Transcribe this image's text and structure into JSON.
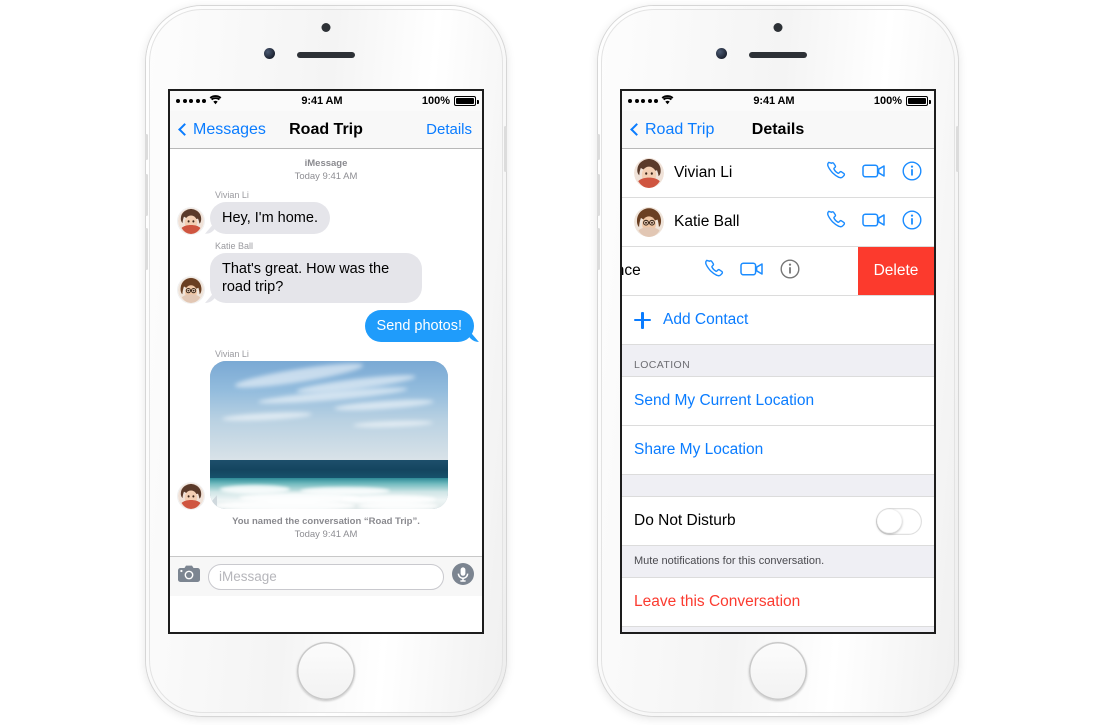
{
  "phones": {
    "left": {
      "status_bar": {
        "signal_dots": 5,
        "wifi_icon": "wifi-icon",
        "time": "9:41 AM",
        "battery_percent": "100%",
        "battery_icon": "battery-full-icon"
      },
      "nav": {
        "back_label": "Messages",
        "back_icon": "chevron-left-icon",
        "title": "Road Trip",
        "right_label": "Details"
      },
      "conversation": {
        "service_stamp": "iMessage",
        "time_stamp": "Today 9:41 AM",
        "messages": [
          {
            "sender": "Vivian Li",
            "text": "Hey, I'm home.",
            "direction": "in",
            "type": "text",
            "avatar": "vivian-avatar"
          },
          {
            "sender": "Katie Ball",
            "text": "That's great. How was the road trip?",
            "direction": "in",
            "type": "text",
            "avatar": "katie-avatar"
          },
          {
            "sender": "",
            "text": "Send photos!",
            "direction": "out",
            "type": "text",
            "avatar": ""
          },
          {
            "sender": "Vivian Li",
            "text": "",
            "direction": "in",
            "type": "photo",
            "avatar": "vivian-avatar",
            "photo_alt": "ocean-beach-photo"
          }
        ],
        "system_note_line1": "You named the conversation “Road Trip”.",
        "system_note_line2": "Today 9:41 AM"
      },
      "input_bar": {
        "camera_icon": "camera-icon",
        "placeholder": "iMessage",
        "value": "",
        "mic_icon": "microphone-icon"
      }
    },
    "right": {
      "status_bar": {
        "signal_dots": 5,
        "wifi_icon": "wifi-icon",
        "time": "9:41 AM",
        "battery_percent": "100%",
        "battery_icon": "battery-full-icon"
      },
      "nav": {
        "back_label": "Road Trip",
        "back_icon": "chevron-left-icon",
        "title": "Details",
        "right_label": ""
      },
      "contacts": [
        {
          "name": "Vivian Li",
          "avatar": "vivian-avatar",
          "swiped": false,
          "actions": [
            "phone-icon",
            "video-icon",
            "info-icon"
          ]
        },
        {
          "name": "Katie Ball",
          "avatar": "katie-avatar",
          "swiped": false,
          "actions": [
            "phone-icon",
            "video-icon",
            "info-icon"
          ]
        },
        {
          "name": "Vance",
          "avatar": "vance-avatar",
          "swiped": true,
          "actions": [
            "phone-icon",
            "video-icon",
            "info-icon"
          ],
          "delete_label": "Delete"
        }
      ],
      "add_contact": {
        "label": "Add Contact",
        "icon": "plus-icon"
      },
      "location_section": {
        "header": "LOCATION",
        "items": [
          {
            "label": "Send My Current Location"
          },
          {
            "label": "Share My Location"
          }
        ]
      },
      "do_not_disturb": {
        "label": "Do Not Disturb",
        "toggle_state": "off",
        "footnote": "Mute notifications for this conversation."
      },
      "leave": {
        "label": "Leave this Conversation"
      }
    }
  },
  "colors": {
    "tint_blue": "#0a7cff",
    "bubble_out": "#1f9cfb",
    "bubble_in": "#e5e5ea",
    "destructive_red": "#fb3b30",
    "delete_red": "#fc3a2d",
    "group_bg": "#efeff4"
  }
}
